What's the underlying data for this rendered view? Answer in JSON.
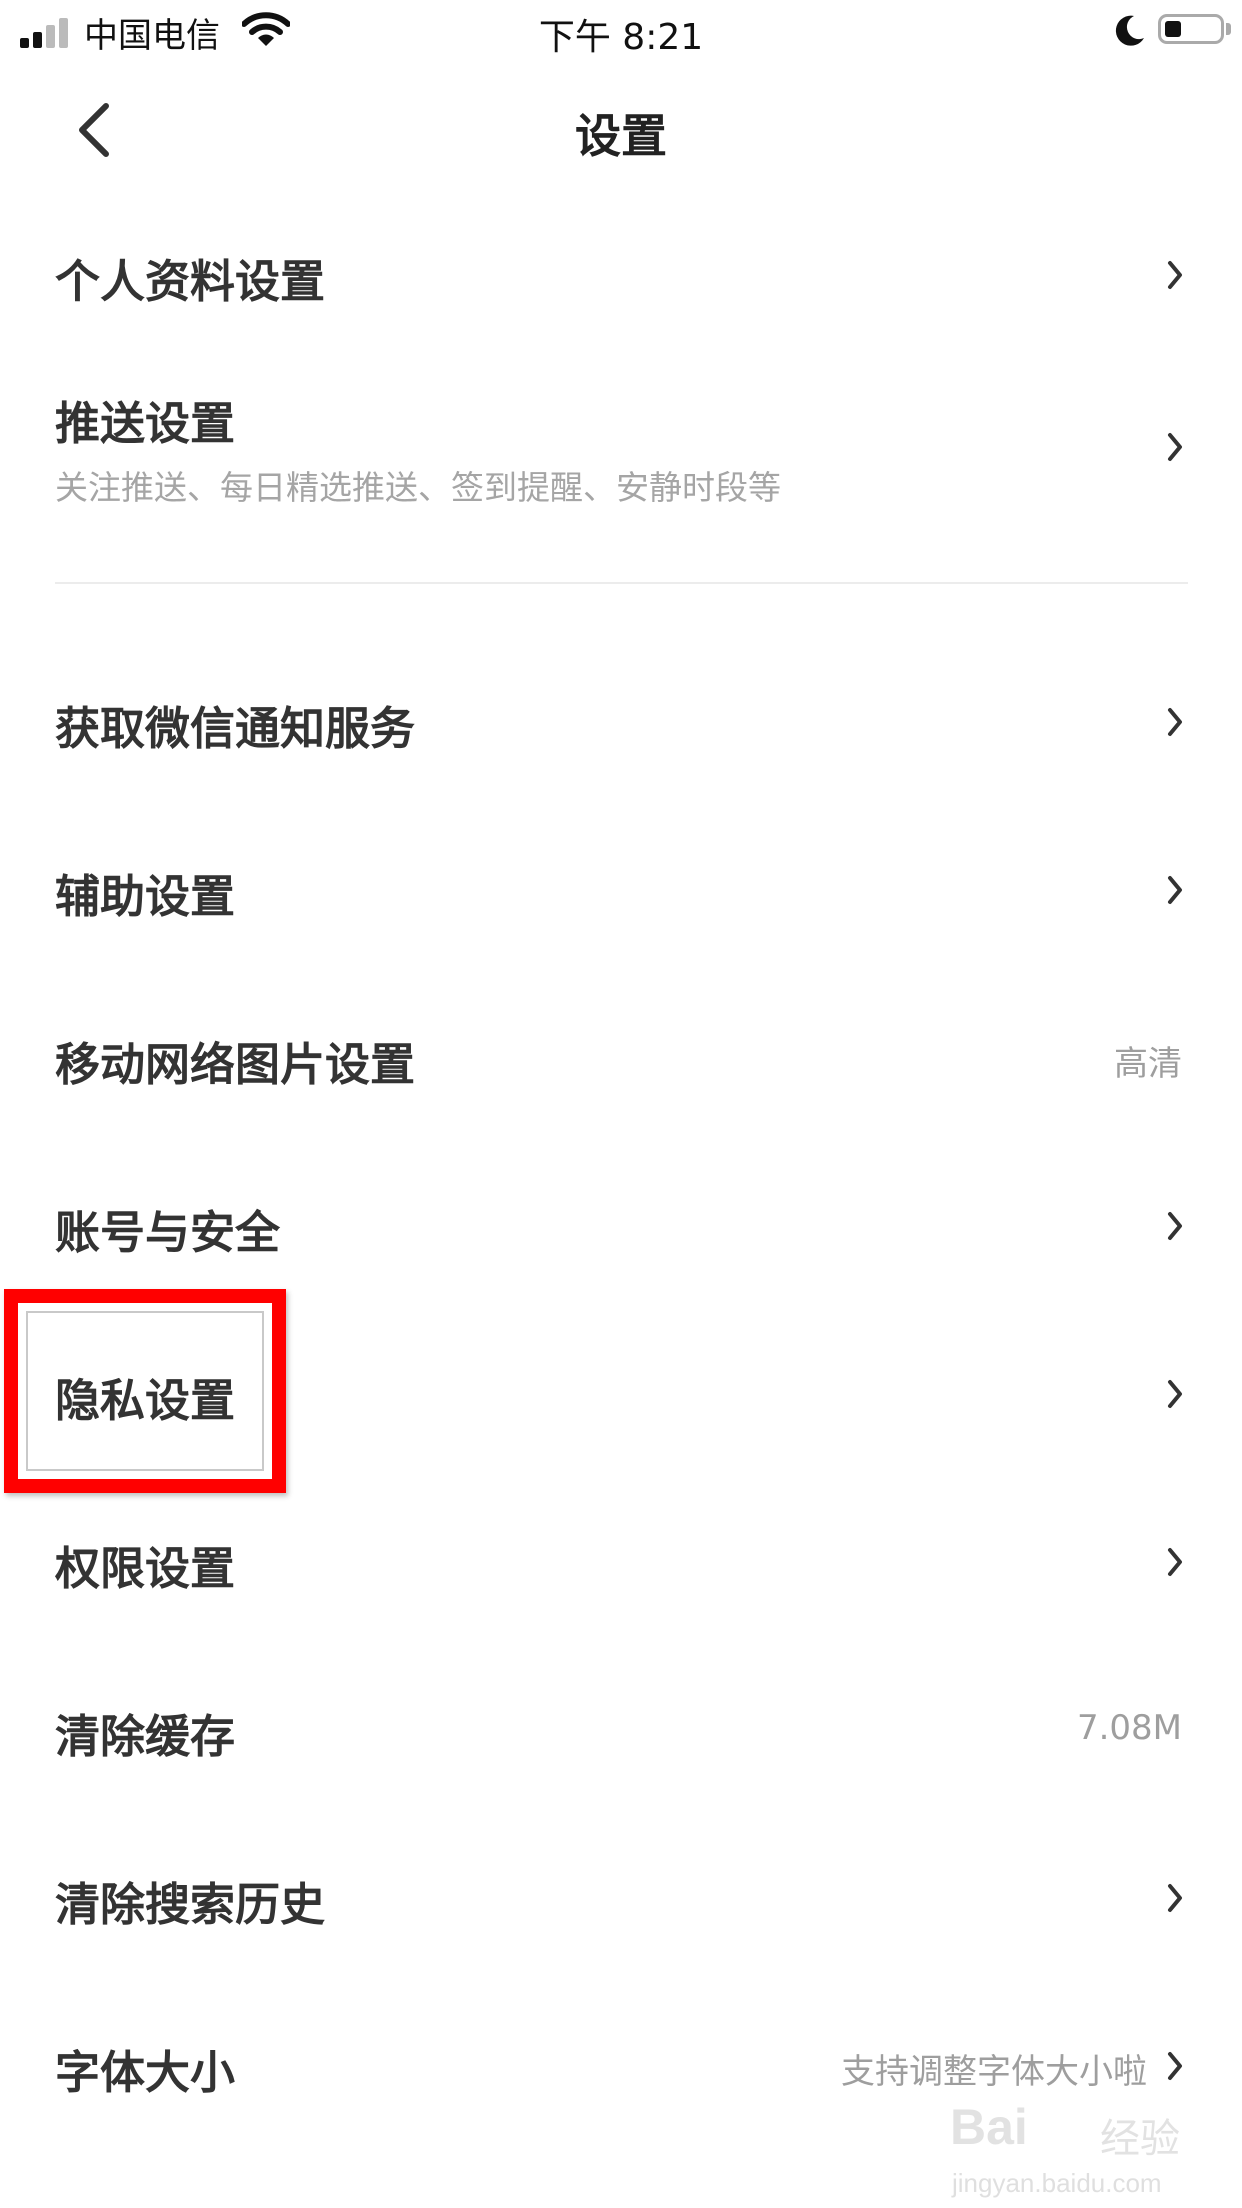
{
  "status_bar": {
    "carrier": "中国电信",
    "time": "下午 8:21"
  },
  "header": {
    "title": "设置",
    "back_icon": "chevron-left-icon"
  },
  "settings": [
    {
      "label": "个人资料设置",
      "value": "",
      "sub": "",
      "chevron": true
    },
    {
      "label": "推送设置",
      "value": "",
      "sub": "关注推送、每日精选推送、签到提醒、安静时段等",
      "chevron": true
    },
    {
      "label": "获取微信通知服务",
      "value": "",
      "sub": "",
      "chevron": true
    },
    {
      "label": "辅助设置",
      "value": "",
      "sub": "",
      "chevron": true
    },
    {
      "label": "移动网络图片设置",
      "value": "高清",
      "sub": "",
      "chevron": false
    },
    {
      "label": "账号与安全",
      "value": "",
      "sub": "",
      "chevron": true
    },
    {
      "label": "隐私设置",
      "value": "",
      "sub": "",
      "chevron": true
    },
    {
      "label": "权限设置",
      "value": "",
      "sub": "",
      "chevron": true
    },
    {
      "label": "清除缓存",
      "value": "7.08M",
      "sub": "",
      "chevron": false
    },
    {
      "label": "清除搜索历史",
      "value": "",
      "sub": "",
      "chevron": true
    },
    {
      "label": "字体大小",
      "value": "支持调整字体大小啦",
      "sub": "",
      "chevron": true
    }
  ],
  "watermark": {
    "logo": "Bai",
    "logo2": "经验",
    "url": "jingyan.baidu.com"
  },
  "colors": {
    "highlight": "#ff0000",
    "text_primary": "#333333",
    "text_secondary": "#a5a5a5"
  }
}
